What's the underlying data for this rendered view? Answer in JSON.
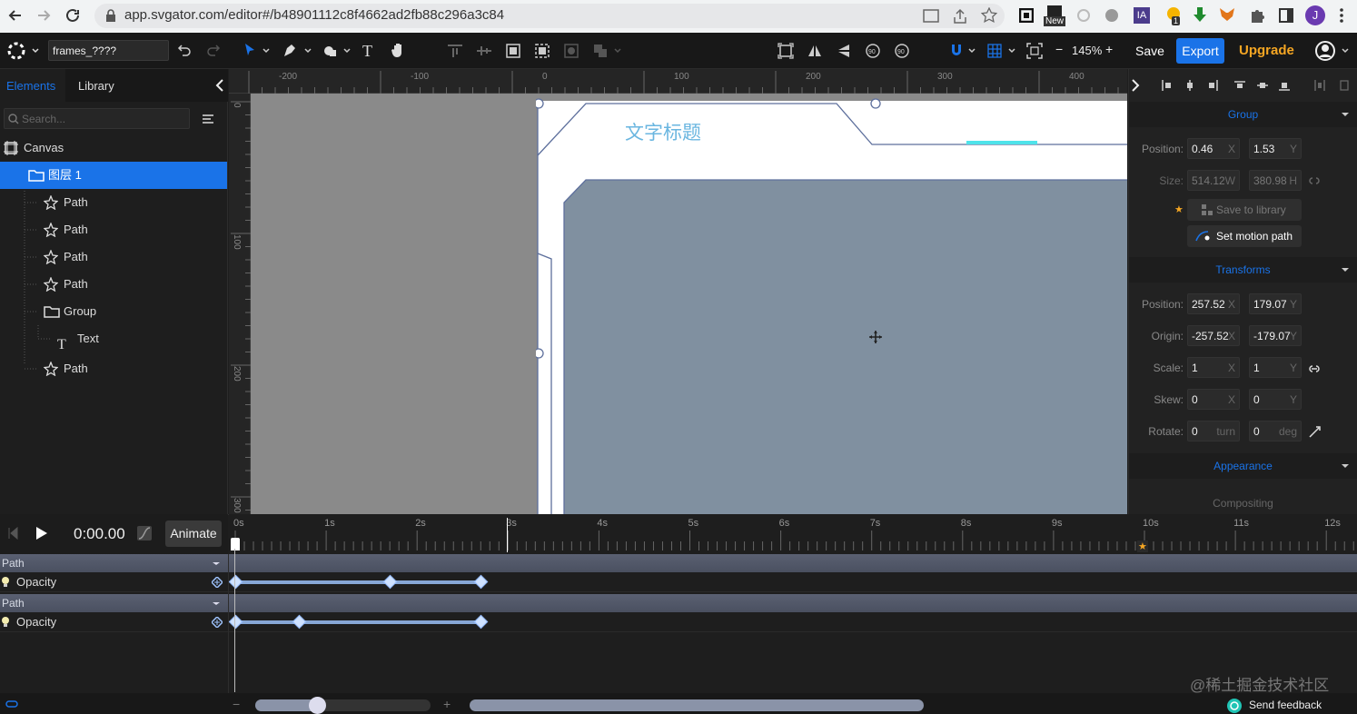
{
  "browser": {
    "url": "app.svgator.com/editor#/b48901112c8f4662ad2fb88c296a3c84",
    "new_badge": "New",
    "ext_badge": "1",
    "profile_initial": "J"
  },
  "toolbar": {
    "file_name": "frames_????",
    "zoom": "145%",
    "save_label": "Save",
    "export_label": "Export",
    "upgrade_label": "Upgrade"
  },
  "left_panel": {
    "tabs": [
      "Elements",
      "Library"
    ],
    "search_placeholder": "Search...",
    "tree": [
      {
        "label": "Canvas",
        "icon": "canvas-icon",
        "indent": 0
      },
      {
        "label": "图层 1",
        "icon": "folder-icon",
        "indent": 1,
        "selected": true
      },
      {
        "label": "Path",
        "icon": "path-icon",
        "indent": 2
      },
      {
        "label": "Path",
        "icon": "path-icon",
        "indent": 2
      },
      {
        "label": "Path",
        "icon": "path-icon",
        "indent": 2
      },
      {
        "label": "Path",
        "icon": "path-icon",
        "indent": 2
      },
      {
        "label": "Group",
        "icon": "folder-icon",
        "indent": 2
      },
      {
        "label": "Text",
        "icon": "text-icon",
        "indent": 3
      },
      {
        "label": "Path",
        "icon": "path-icon",
        "indent": 2
      }
    ]
  },
  "canvas": {
    "ruler_top": [
      "-200",
      "-100",
      "0",
      "100",
      "200",
      "300",
      "400"
    ],
    "ruler_left": [
      "0",
      "100",
      "200",
      "300"
    ],
    "title_text": "文字标题"
  },
  "right_panel": {
    "group_section": "Group",
    "position_label": "Position:",
    "position_x": "0.46",
    "position_y": "1.53",
    "size_label": "Size:",
    "size_w": "514.12",
    "size_h": "380.98",
    "save_library": "Save to library",
    "motion_path": "Set motion path",
    "transforms_section": "Transforms",
    "t_position_x": "257.52",
    "t_position_y": "179.07",
    "origin_label": "Origin:",
    "origin_x": "-257.52",
    "origin_y": "-179.07",
    "scale_label": "Scale:",
    "scale_x": "1",
    "scale_y": "1",
    "skew_label": "Skew:",
    "skew_x": "0",
    "skew_y": "0",
    "rotate_label": "Rotate:",
    "rotate_turn": "0",
    "rotate_deg": "0",
    "turn_unit": "turn",
    "deg_unit": "deg",
    "appearance_section": "Appearance",
    "compositing_section": "Compositing",
    "axis_x": "X",
    "axis_y": "Y",
    "axis_w": "W",
    "axis_h": "H"
  },
  "timeline": {
    "time": "0:00.00",
    "animate_label": "Animate",
    "ticks": [
      "0s",
      "1s",
      "2s",
      "3s",
      "4s",
      "5s",
      "6s",
      "7s",
      "8s",
      "9s",
      "10s",
      "11s",
      "12s"
    ],
    "tracks": [
      {
        "name": "Path",
        "property": "Opacity",
        "keyframes_s": [
          0,
          1.7,
          2.7
        ]
      },
      {
        "name": "Path",
        "property": "Opacity",
        "keyframes_s": [
          0,
          0.7,
          2.7
        ]
      }
    ],
    "feedback": "Send feedback",
    "watermark": "@稀土掘金技术社区"
  }
}
